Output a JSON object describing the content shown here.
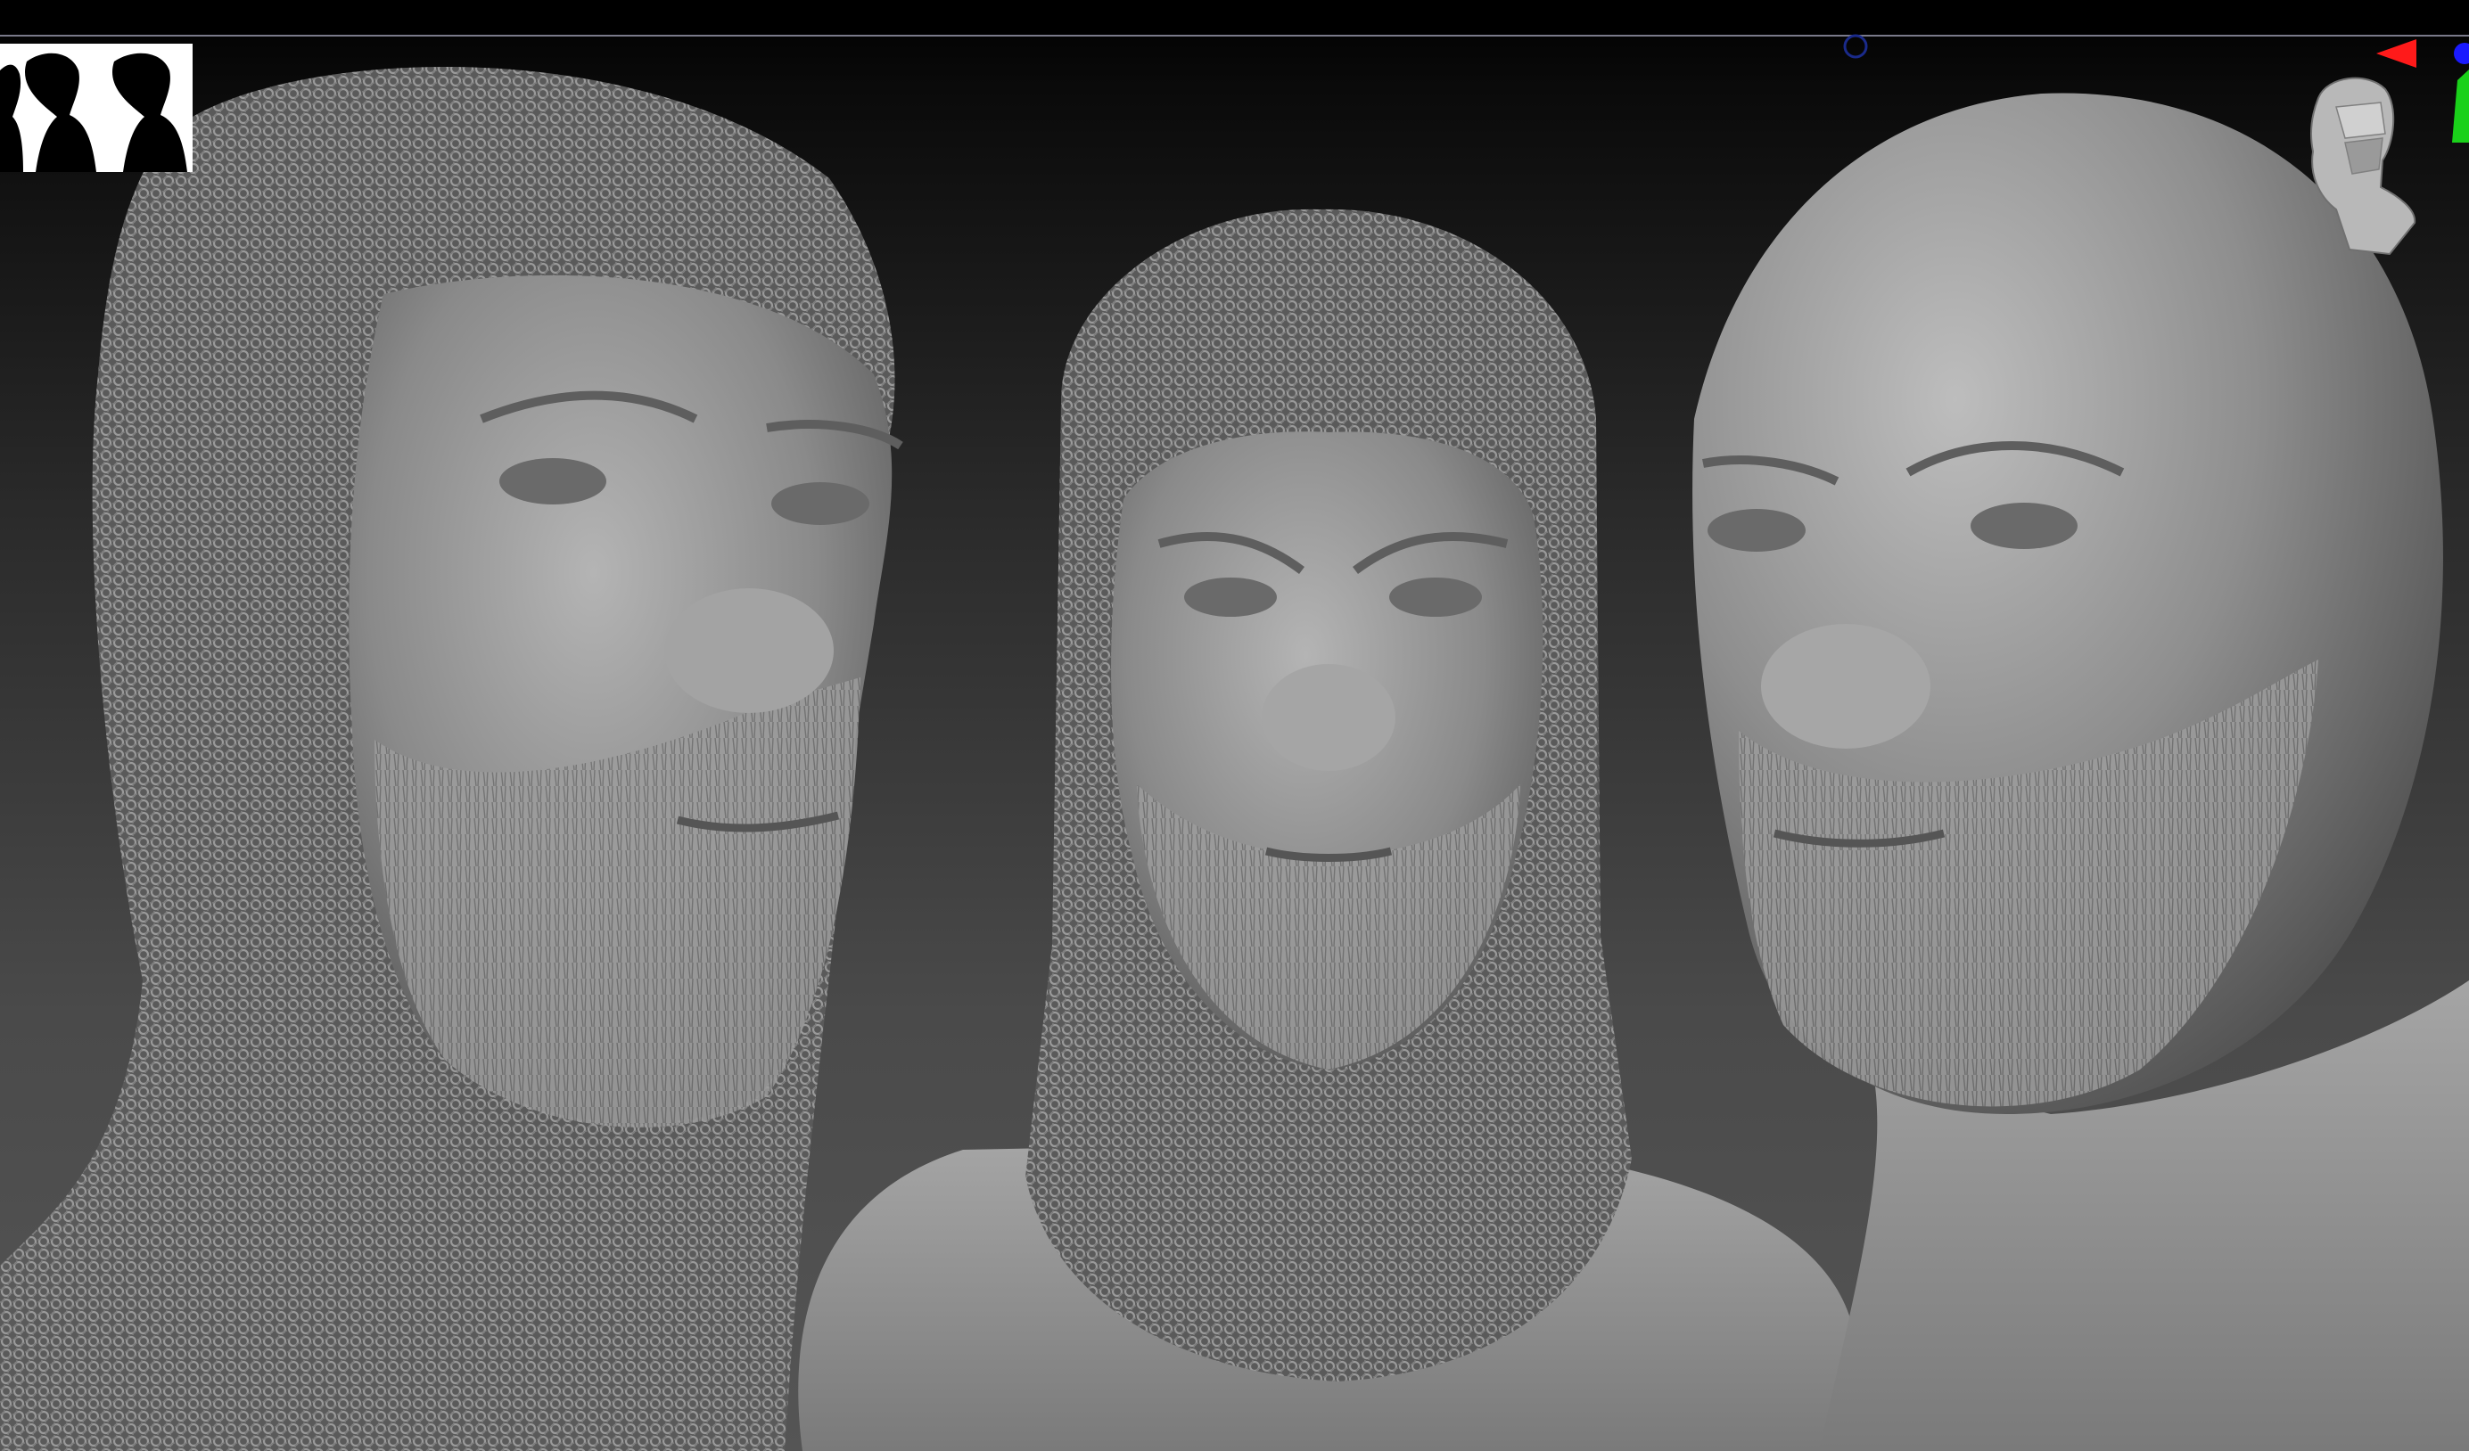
{
  "viewport": {
    "background_top": "#000000",
    "background_bottom": "#555555"
  },
  "icons": {
    "logo": "two-silhouettes-logo-icon",
    "navigation": "head-orientation-gizmo-icon",
    "axes": "xyz-axis-gizmo-icon",
    "marker": "circle-marker-icon"
  },
  "colors": {
    "axis_x": "#ff1a1a",
    "axis_y": "#1ad11a",
    "axis_z": "#1a1aff",
    "marker": "#1a2a8a",
    "mesh": "#8c8c8c"
  },
  "models": [
    {
      "name": "head-chainmail-three-quarter"
    },
    {
      "name": "head-chainmail-front"
    },
    {
      "name": "head-bald-three-quarter"
    }
  ]
}
